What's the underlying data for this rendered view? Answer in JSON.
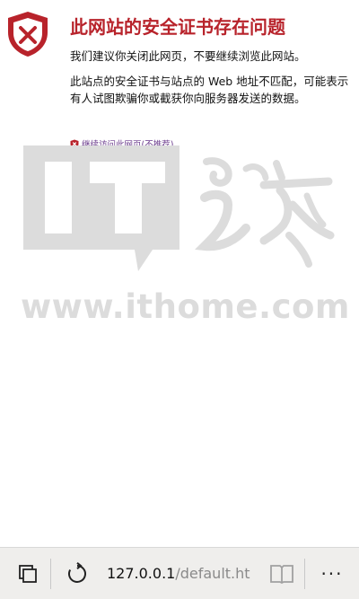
{
  "error": {
    "title": "此网站的安全证书存在问题",
    "recommendation": "我们建议你关闭此网页，不要继续浏览此网站。",
    "detail": "此站点的安全证书与站点的 Web 地址不匹配，可能表示有人试图欺骗你或截获你向服务器发送的数据。",
    "continue_link": "继续访问此网页(不推荐)"
  },
  "watermark": {
    "logo_text": "IT之家",
    "url": "www.ithome.com"
  },
  "address_bar": {
    "host": "127.0.0.1",
    "path": "/default.ht"
  },
  "toolbar": {
    "more_label": "···"
  },
  "colors": {
    "error_red": "#b8232b",
    "link_purple": "#6a3a8c",
    "bar_background": "#efeeec"
  }
}
